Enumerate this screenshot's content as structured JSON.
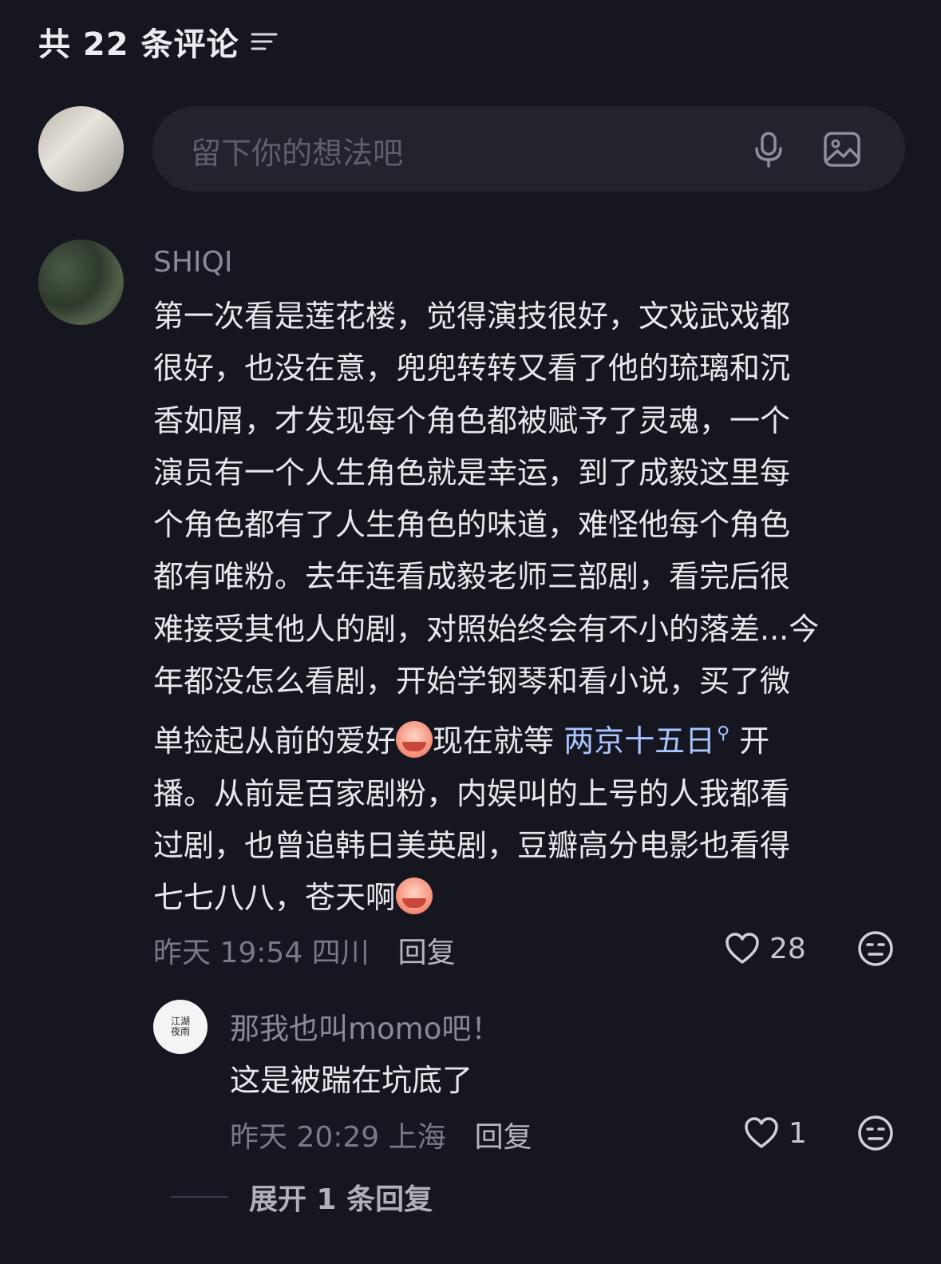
{
  "header": {
    "title": "共 22 条评论"
  },
  "composer": {
    "placeholder": "留下你的想法吧"
  },
  "comment": {
    "username": "SHIQI",
    "lines": [
      "第一次看是莲花楼，觉得演技很好，文戏武戏都",
      "很好，也没在意，兜兜转转又看了他的琉璃和沉",
      "香如屑，才发现每个角色都被赋予了灵魂，一个",
      "演员有一个人生角色就是幸运，到了成毅这里每",
      "个角色都有了人生角色的味道，难怪他每个角色",
      "都有唯粉。去年连看成毅老师三部剧，看完后很",
      "难接受其他人的剧，对照始终会有不小的落差...今",
      "年都没怎么看剧，开始学钢琴和看小说，买了微",
      "单捡起从前的爱好"
    ],
    "line9_after_emoji": "现在就等",
    "link_text": "两京十五日",
    "line9_tail": "开",
    "line10": "播。从前是百家剧粉，内娱叫的上号的人我都看",
    "line11": "过剧，也曾追韩日美英剧，豆瓣高分电影也看得",
    "line12": "七七八八，苍天啊",
    "time": "昨天 19:54 四川",
    "reply_label": "回复",
    "likes": "28"
  },
  "reply": {
    "avatar_text": "江湖\n夜雨",
    "username": "那我也叫momo吧！",
    "text": "这是被踹在坑底了",
    "time": "昨天 20:29 上海",
    "reply_label": "回复",
    "likes": "1"
  },
  "expand": {
    "label": "展开 1 条回复"
  }
}
